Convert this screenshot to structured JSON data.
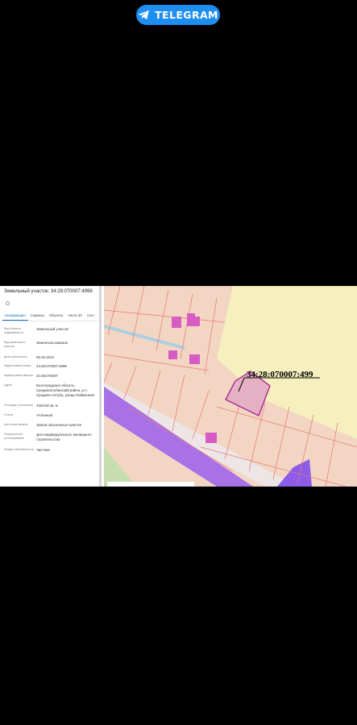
{
  "telegram": {
    "label": "TELEGRAM",
    "color": "#1f8ef1"
  },
  "panel": {
    "title": "Земельный участок: 34:28:070007:4999",
    "tabs": [
      "Информация",
      "Сервисы",
      "Объекты",
      "Части ЗУ",
      "Сост"
    ],
    "rows": [
      {
        "key": "Вид объекта недвижимости",
        "value": "Земельный участок"
      },
      {
        "key": "Вид земельного участка",
        "value": "Землепользование"
      },
      {
        "key": "Дата присвоения",
        "value": "05.03.2024"
      },
      {
        "key": "Кадастровый номер",
        "value": "34:28:070007:4999"
      },
      {
        "key": "Кадастровый квартал",
        "value": "34:28:070007"
      },
      {
        "key": "Адрес",
        "value": "Волгоградская область, Среднеахтубинский район, р.п. Средняя Ахтуба, улица Пойменная"
      },
      {
        "key": "Площадь уточненная",
        "value": "100/100 кв. м"
      },
      {
        "key": "Статус",
        "value": "Учтенный"
      },
      {
        "key": "Категория земель",
        "value": "Земли населенных пунктов"
      },
      {
        "key": "Разрешенное использование",
        "value": "Для индивидуального жилищного строительства"
      },
      {
        "key": "Форма собственности",
        "value": "Частная"
      }
    ]
  },
  "map": {
    "parcel_label": "34:28:070007:499"
  },
  "colors": {
    "parcel_fill": "#f3d5c4",
    "boundary": "#e87872",
    "building": "#d65cc3",
    "road": "#9e6be8",
    "field": "#f6f0be"
  }
}
